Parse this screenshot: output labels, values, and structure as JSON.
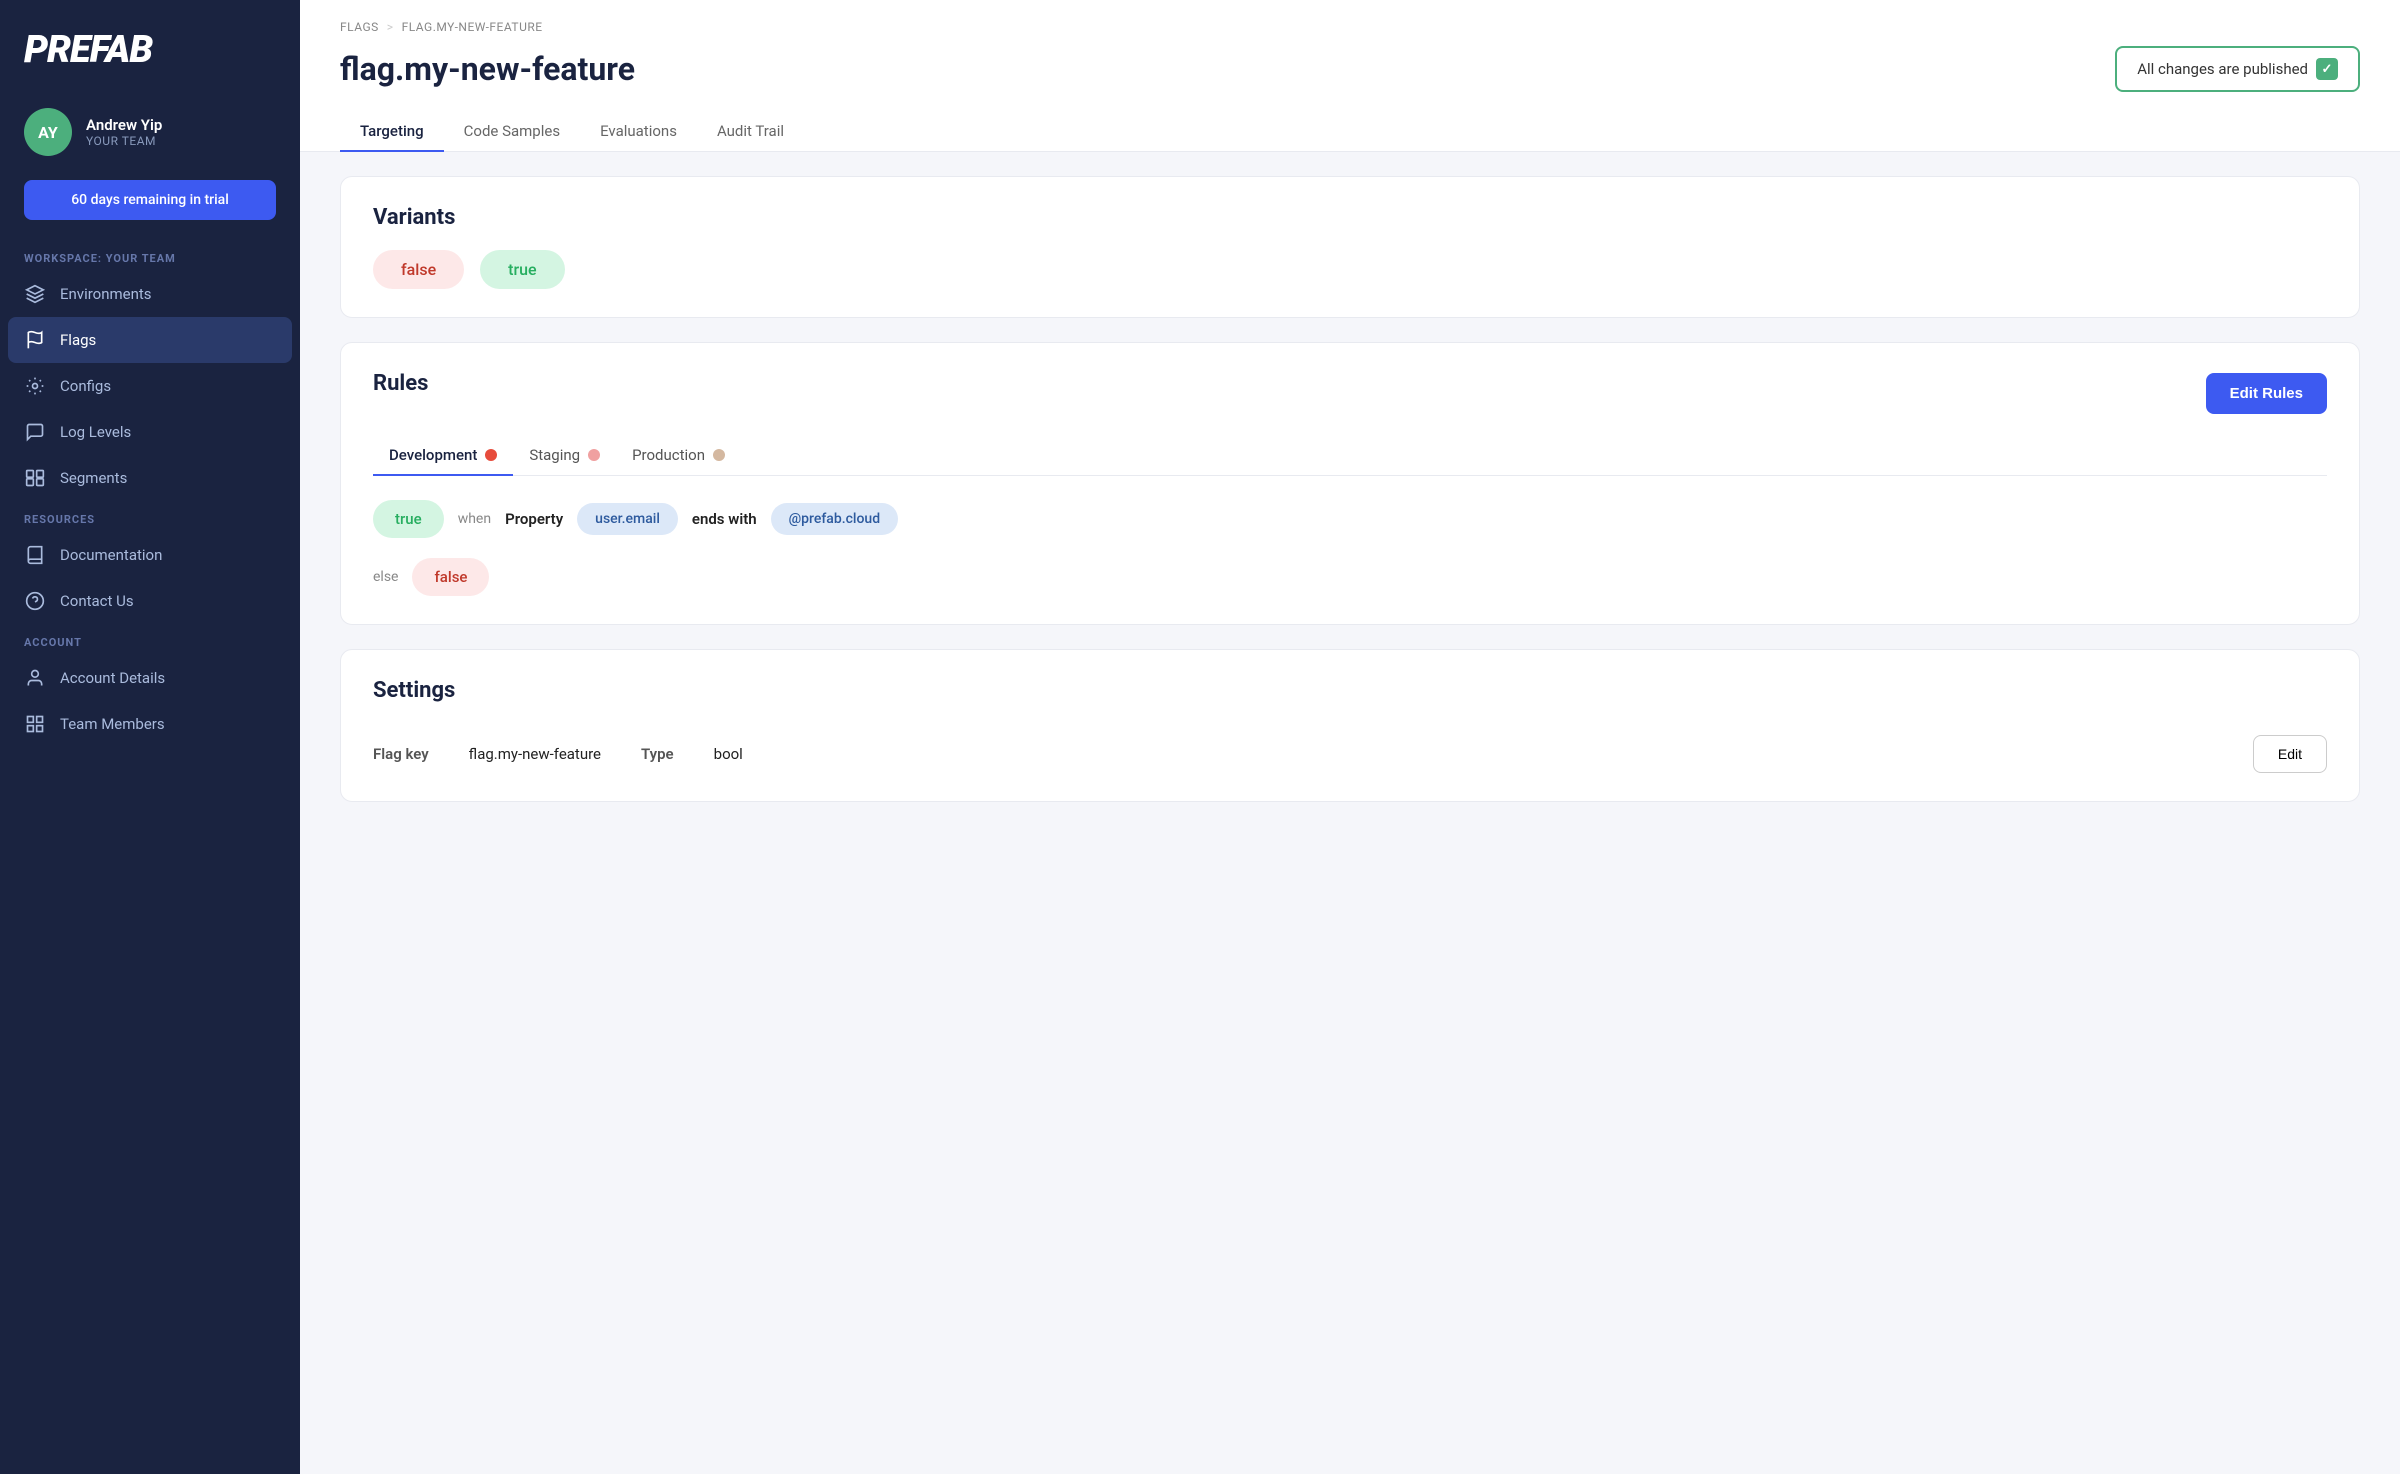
{
  "sidebar": {
    "logo": "PREFAB",
    "user": {
      "initials": "AY",
      "name": "Andrew Yip",
      "team": "YOUR TEAM"
    },
    "trial_badge": "60 days remaining in trial",
    "workspace_label": "WORKSPACE: YOUR TEAM",
    "nav_items": [
      {
        "id": "environments",
        "label": "Environments",
        "icon": "environments"
      },
      {
        "id": "flags",
        "label": "Flags",
        "icon": "flags",
        "active": true
      },
      {
        "id": "configs",
        "label": "Configs",
        "icon": "configs"
      },
      {
        "id": "log-levels",
        "label": "Log Levels",
        "icon": "log-levels"
      },
      {
        "id": "segments",
        "label": "Segments",
        "icon": "segments"
      }
    ],
    "resources_label": "RESOURCES",
    "resource_items": [
      {
        "id": "documentation",
        "label": "Documentation",
        "icon": "book"
      },
      {
        "id": "contact-us",
        "label": "Contact Us",
        "icon": "help"
      }
    ],
    "account_label": "ACCOUNT",
    "account_items": [
      {
        "id": "account-details",
        "label": "Account Details",
        "icon": "user"
      },
      {
        "id": "team-members",
        "label": "Team Members",
        "icon": "team"
      }
    ]
  },
  "breadcrumb": {
    "parent": "FLAGS",
    "separator": ">",
    "current": "FLAG.MY-NEW-FEATURE"
  },
  "page": {
    "title": "flag.my-new-feature",
    "published_badge": "All changes are published",
    "published_check": "✓"
  },
  "tabs": [
    {
      "id": "targeting",
      "label": "Targeting",
      "active": true
    },
    {
      "id": "code-samples",
      "label": "Code Samples"
    },
    {
      "id": "evaluations",
      "label": "Evaluations"
    },
    {
      "id": "audit-trail",
      "label": "Audit Trail"
    }
  ],
  "variants": {
    "title": "Variants",
    "items": [
      {
        "id": "false",
        "label": "false",
        "type": "false"
      },
      {
        "id": "true",
        "label": "true",
        "type": "true"
      }
    ]
  },
  "rules": {
    "title": "Rules",
    "edit_button": "Edit Rules",
    "environments": [
      {
        "id": "development",
        "label": "Development",
        "dot": "target",
        "active": true
      },
      {
        "id": "staging",
        "label": "Staging",
        "dot": "salmon"
      },
      {
        "id": "production",
        "label": "Production",
        "dot": "tan"
      }
    ],
    "rule": {
      "result": "true",
      "when_text": "when",
      "property_text": "Property",
      "property_value": "user.email",
      "condition_text": "ends with",
      "match_value": "@prefab.cloud"
    },
    "else_result": "false"
  },
  "settings": {
    "title": "Settings",
    "flag_key_label": "Flag key",
    "flag_key_value": "flag.my-new-feature",
    "type_label": "Type",
    "type_value": "bool",
    "edit_button": "Edit"
  }
}
